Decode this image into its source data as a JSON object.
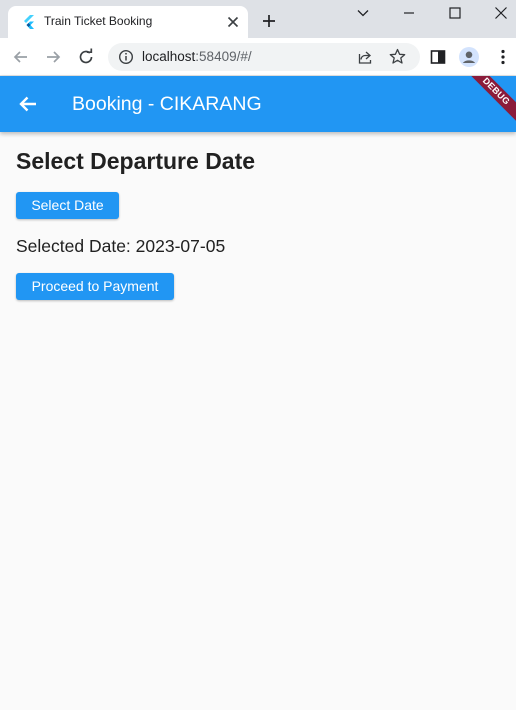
{
  "browser": {
    "tab_title": "Train Ticket Booking",
    "url_host": "localhost",
    "url_port_path": ":58409/#/"
  },
  "app": {
    "appbar_title": "Booking - CIKARANG",
    "debug_label": "DEBUG",
    "heading": "Select Departure Date",
    "select_date_label": "Select Date",
    "selected_date_text": "Selected Date: 2023-07-05",
    "proceed_label": "Proceed to Payment"
  },
  "colors": {
    "primary": "#2196f3",
    "debug_banner": "#8b1b3a",
    "background": "#fafafa"
  },
  "icons": [
    "flutter-logo-icon",
    "close-icon",
    "plus-icon",
    "chevron-down-icon",
    "minimize-icon",
    "maximize-icon",
    "close-window-icon",
    "back-icon",
    "forward-icon",
    "reload-icon",
    "info-icon",
    "share-icon",
    "star-icon",
    "side-panel-icon",
    "profile-icon",
    "menu-icon",
    "arrow-back-icon"
  ]
}
